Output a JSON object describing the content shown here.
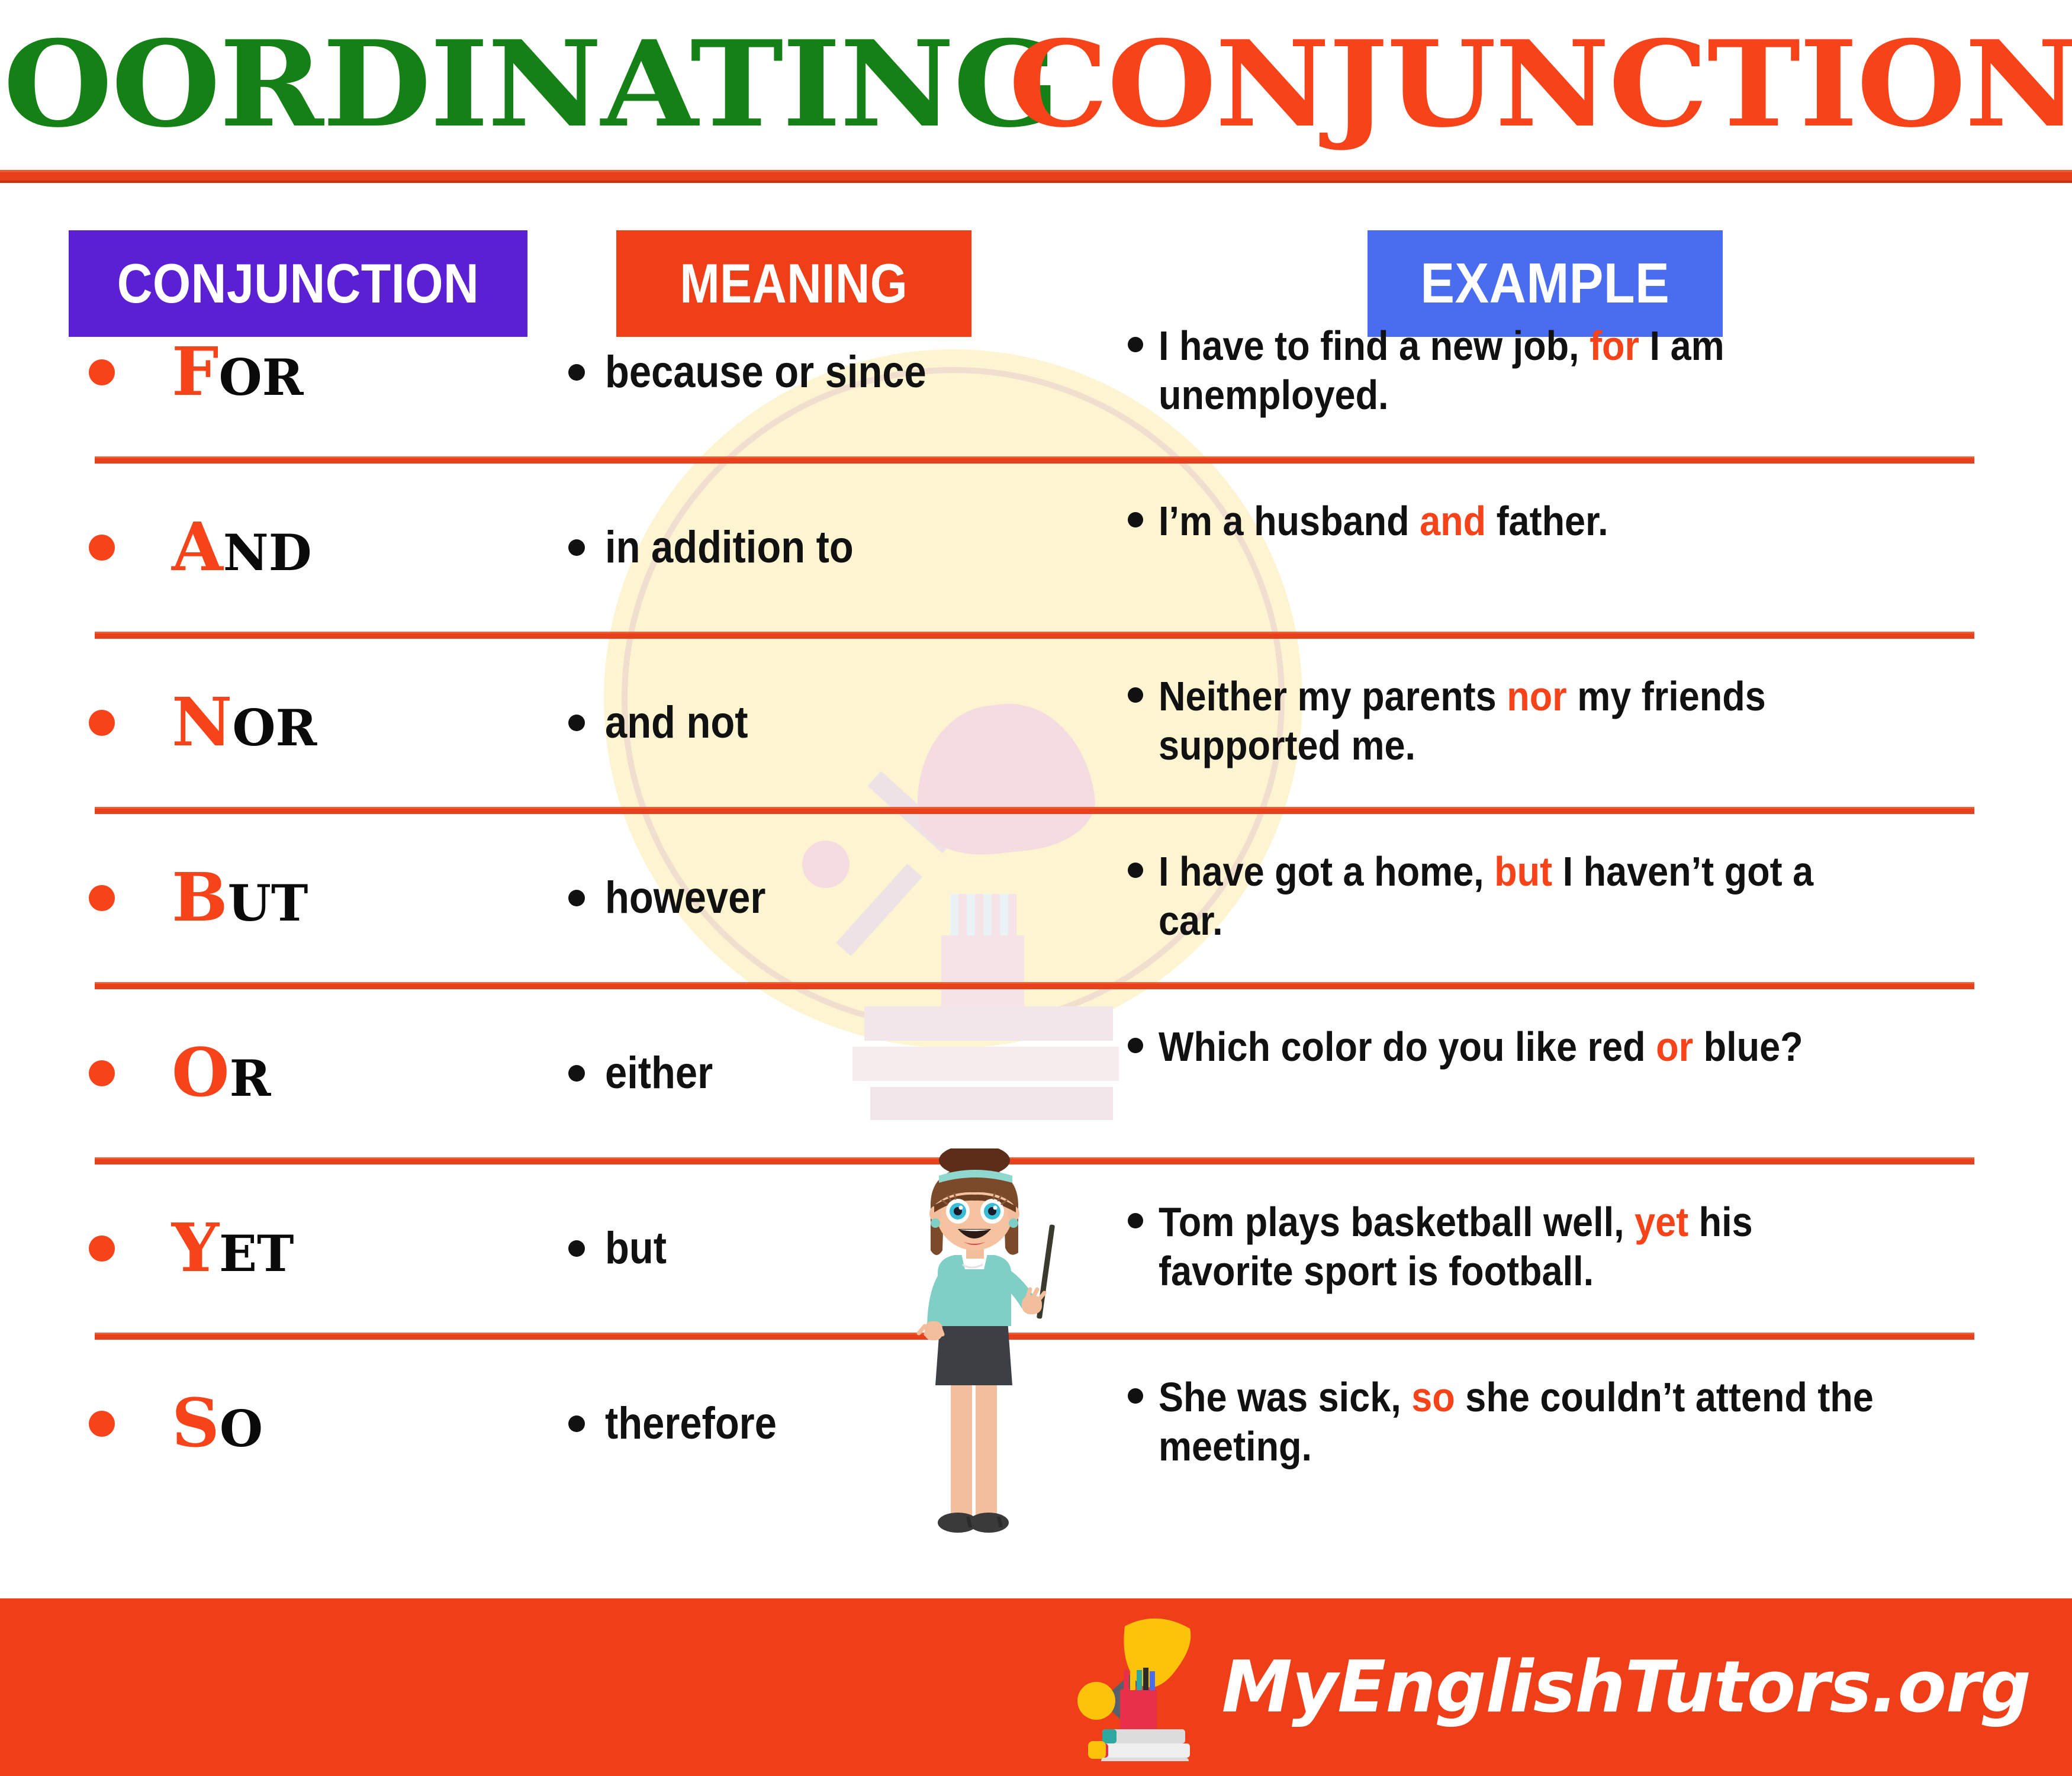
{
  "title": {
    "word1": "COORDINATING",
    "word2": "CONJUNCTIONS",
    "color1": "#158015",
    "color2": "#F7431A"
  },
  "colors": {
    "accent_orange": "#F7431A",
    "rule_orange": "#E8401C",
    "header_conjunction_bg": "#5B1FD4",
    "header_meaning_bg": "#EE3F18",
    "header_example_bg": "#4A6DF0",
    "footer_bg": "#EE3F18",
    "watermark": "#FDF4D2",
    "text_black": "#111111"
  },
  "table": {
    "headers": {
      "conjunction": "CONJUNCTION",
      "meaning": "MEANING",
      "example": "EXAMPLE"
    },
    "rows": [
      {
        "conjunction_first": "F",
        "conjunction_rest": "OR",
        "meaning": "because or since",
        "example_pre": "I have to find a new job, ",
        "example_highlight": "for",
        "example_post": " I am unemployed."
      },
      {
        "conjunction_first": "A",
        "conjunction_rest": "ND",
        "meaning": "in addition to",
        "example_pre": "I’m a husband ",
        "example_highlight": "and",
        "example_post": " father."
      },
      {
        "conjunction_first": "N",
        "conjunction_rest": "OR",
        "meaning": "and not",
        "example_pre": "Neither my parents ",
        "example_highlight": "nor",
        "example_post": " my friends supported me."
      },
      {
        "conjunction_first": "B",
        "conjunction_rest": "UT",
        "meaning": "however",
        "example_pre": "I have got a home, ",
        "example_highlight": "but",
        "example_post": " I haven’t got a car."
      },
      {
        "conjunction_first": "O",
        "conjunction_rest": "R",
        "meaning": "either",
        "example_pre": "Which color do you like red ",
        "example_highlight": "or",
        "example_post": " blue?"
      },
      {
        "conjunction_first": "Y",
        "conjunction_rest": "ET",
        "meaning": "but",
        "example_pre": "Tom plays basketball well, ",
        "example_highlight": "yet",
        "example_post": " his favorite sport is football."
      },
      {
        "conjunction_first": "S",
        "conjunction_rest": "O",
        "meaning": "therefore",
        "example_pre": "She was sick, ",
        "example_highlight": "so",
        "example_post": " she couldn’t attend the meeting."
      }
    ]
  },
  "illustration": {
    "teacher": "teacher-pointing-illustration",
    "watermark": "desk-lamp-books-watermark"
  },
  "footer": {
    "brand": "MyEnglishTutors.org",
    "logo_icon": "desk-lamp-books-logo-icon"
  }
}
